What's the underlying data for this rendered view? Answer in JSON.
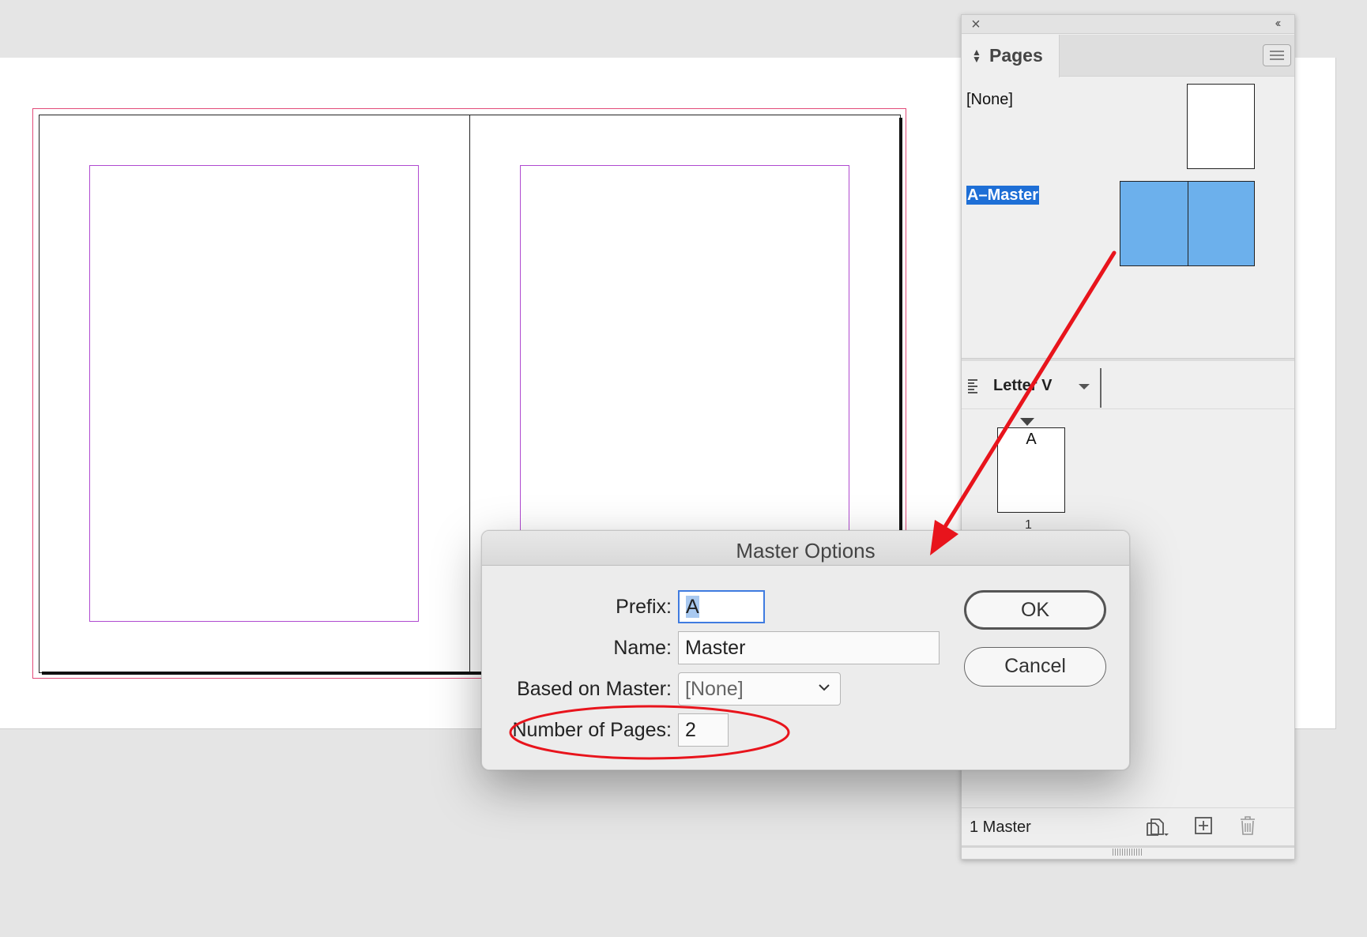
{
  "pages_panel": {
    "close_icon": "close-icon",
    "collapse_icon": "collapse-icon",
    "tab_label": "Pages",
    "sort_icon": "sort-icon",
    "menu_icon": "panel-menu-icon",
    "masters": [
      {
        "label": "[None]"
      },
      {
        "label": "A–Master",
        "selected": true,
        "highlight_color": "#1e6fd6",
        "thumb_color": "#6cb0ec"
      }
    ],
    "page_size": "Letter V",
    "page_thumb": {
      "prefix": "A",
      "number": "1"
    },
    "footer": {
      "status": "1 Master",
      "icons": [
        "edit-page-size-icon",
        "new-page-icon",
        "trash-icon"
      ]
    }
  },
  "dialog": {
    "title": "Master Options",
    "fields": {
      "prefix": {
        "label": "Prefix:",
        "value": "A"
      },
      "name": {
        "label": "Name:",
        "value": "Master"
      },
      "based_on": {
        "label": "Based on Master:",
        "value": "[None]"
      },
      "num_pages": {
        "label": "Number of Pages:",
        "value": "2"
      }
    },
    "buttons": {
      "ok": "OK",
      "cancel": "Cancel"
    }
  },
  "annotations": {
    "color": "#e8141c",
    "arrow": "from A–Master thumbnail to Master Options dialog",
    "ellipse": "around Number of Pages field"
  },
  "colors": {
    "bleed_guide": "#e24a78",
    "margin_guide": "#b04ad0",
    "focus_ring": "#3f7be0"
  }
}
